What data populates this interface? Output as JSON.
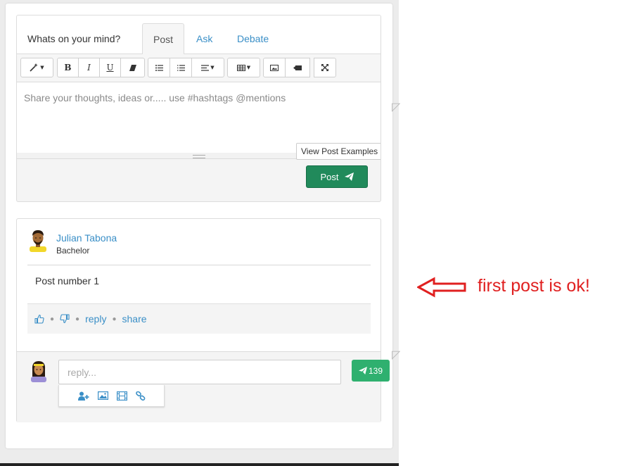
{
  "composer": {
    "prompt": "Whats on your mind?",
    "tabs": [
      {
        "label": "Post",
        "active": true
      },
      {
        "label": "Ask",
        "active": false
      },
      {
        "label": "Debate",
        "active": false
      }
    ],
    "toolbar_icons": [
      "magic-wand-icon",
      "bold-icon",
      "italic-icon",
      "underline-icon",
      "eraser-icon",
      "bullet-list-icon",
      "numbered-list-icon",
      "align-icon",
      "table-icon",
      "picture-icon",
      "video-icon",
      "fullscreen-icon"
    ],
    "toolbar_letters": {
      "bold": "B",
      "italic": "I",
      "underline": "U"
    },
    "placeholder": "Share your thoughts, ideas or..... use #hashtags @mentions",
    "examples_label": "View Post Examples",
    "post_label": "Post"
  },
  "post": {
    "author_name": "Julian Tabona",
    "author_role": "Bachelor",
    "body": "Post number 1",
    "actions": {
      "reply": "reply",
      "share": "share"
    },
    "reply_placeholder": "reply...",
    "send_count": "139"
  },
  "annotation": {
    "text": "first post is ok!",
    "color": "#e02020"
  },
  "colors": {
    "link": "#3a8fc7",
    "post_button": "#218a5b",
    "send_button": "#2fb06f"
  }
}
